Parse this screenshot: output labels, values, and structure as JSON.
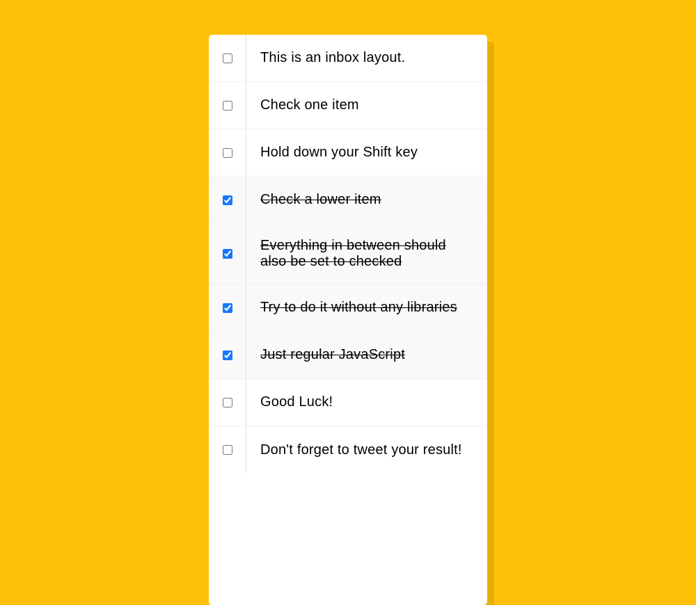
{
  "items": [
    {
      "label": "This is an inbox layout.",
      "checked": false
    },
    {
      "label": "Check one item",
      "checked": false
    },
    {
      "label": "Hold down your Shift key",
      "checked": false
    },
    {
      "label": "Check a lower item",
      "checked": true
    },
    {
      "label": "Everything in between should also be set to checked",
      "checked": true
    },
    {
      "label": "Try to do it without any libraries",
      "checked": true
    },
    {
      "label": "Just regular JavaScript",
      "checked": true
    },
    {
      "label": "Good Luck!",
      "checked": false
    },
    {
      "label": "Don't forget to tweet your result!",
      "checked": false
    }
  ]
}
